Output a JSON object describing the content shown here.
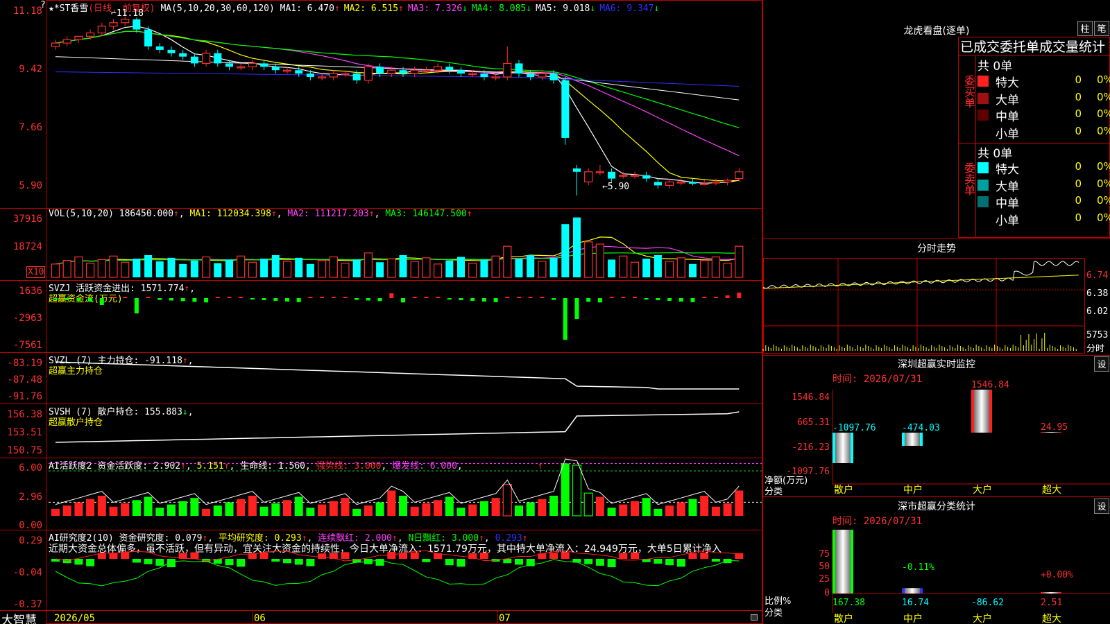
{
  "main_chart": {
    "stock_name": "★*ST香雪",
    "period": "(日线, 前复权)",
    "ma_header": "MA(5,10,20,30,60,120)",
    "ma": [
      {
        "label": "MA1:",
        "value": "6.470",
        "arrow": "↑",
        "color": "#ffffff"
      },
      {
        "label": "MA2:",
        "value": "6.515",
        "arrow": "↑",
        "color": "#ffff00"
      },
      {
        "label": "MA3:",
        "value": "7.326",
        "arrow": "↓",
        "color": "#ff40ff"
      },
      {
        "label": "MA4:",
        "value": "8.085",
        "arrow": "↓",
        "color": "#00ff00"
      },
      {
        "label": "MA5:",
        "value": "9.018",
        "arrow": "↓",
        "color": "#ffffff"
      },
      {
        "label": "MA6:",
        "value": "9.347",
        "arrow": "↓",
        "color": "#3030ff"
      }
    ],
    "y_ticks": [
      "11.18",
      "9.42",
      "7.66",
      "5.90"
    ],
    "high_marker": "11.18",
    "low_marker": "←5.90",
    "help_mark": "?"
  },
  "vol": {
    "header": "VOL(5,10,20)",
    "value": "186450.000",
    "ma1": "112034.398",
    "ma2": "111217.203",
    "ma3": "146147.500",
    "ticks": [
      "37916",
      "18724"
    ],
    "unit": "X10"
  },
  "svzj": {
    "header": "SVZJ  活跃资金进出:",
    "value": "1571.774",
    "sub": "超赢资金流(万元)",
    "ticks": [
      "1636",
      "-2963",
      "-7561"
    ]
  },
  "svzl": {
    "header": "SVZL (7) 主力持仓:",
    "value": "-91.118",
    "sub": "超赢主力持仓",
    "ticks": [
      "-83.19",
      "-87.48",
      "-91.76"
    ]
  },
  "svsh": {
    "header": "SVSH (7) 散户持仓:",
    "value": "155.883",
    "sub": "超赢散户持仓",
    "ticks": [
      "156.38",
      "153.51",
      "150.75"
    ]
  },
  "ai_active": {
    "header": "AI活跃度2 资金活跃度:",
    "v1": "2.902",
    "v2": "5.151",
    "life": "生命线:",
    "life_v": "1.560",
    "strong": "强势线:",
    "strong_v": "3.000",
    "burst": "爆发线:",
    "burst_v": "6.000",
    "ticks": [
      "6.00",
      "2.96",
      "0.00"
    ]
  },
  "ai_research": {
    "header": "AI研究度2(10) 资金研究度:",
    "v1": "0.079",
    "avg": "平均研究度:",
    "avg_v": "0.293",
    "cont": "连续飘红:",
    "cont_v": "2.000",
    "nday": "N日飘红:",
    "nday_v": "3.000",
    "v5": "0.293",
    "text": "近期大资金总体偏多，虽不活跃，但有异动，宜关注大资金的持续性，今日大单净流入：1571.79万元，其中特大单净流入：24.949万元，大单5日累计净入",
    "ticks": [
      "0.29",
      "-0.04",
      "-0.37"
    ]
  },
  "bottom_bar": {
    "brand": "大智慧",
    "dates": [
      "2026/05",
      "06",
      "07"
    ]
  },
  "dragon_tiger": {
    "title": "龙虎看盘(逐单)",
    "btn1": "柱",
    "btn2": "笔",
    "subtitle": "已成交委托单成交量统计",
    "buy_label": "委买单",
    "sell_label": "委卖单",
    "buy_total": "共 0单",
    "sell_total": "共 0单",
    "buy_rows": [
      {
        "name": "特大",
        "count": "0",
        "pct": "0%",
        "color": "#ff2020"
      },
      {
        "name": "大单",
        "count": "0",
        "pct": "0%",
        "color": "#a01010"
      },
      {
        "name": "中单",
        "count": "0",
        "pct": "0%",
        "color": "#600000"
      },
      {
        "name": "小单",
        "count": "0",
        "pct": "0%",
        "color": "#000000"
      }
    ],
    "sell_rows": [
      {
        "name": "特大",
        "count": "0",
        "pct": "0%",
        "color": "#00ffff"
      },
      {
        "name": "大单",
        "count": "0",
        "pct": "0%",
        "color": "#00a0a0"
      },
      {
        "name": "中单",
        "count": "0",
        "pct": "0%",
        "color": "#007070"
      },
      {
        "name": "小单",
        "count": "0",
        "pct": "0%",
        "color": "#000000"
      }
    ]
  },
  "intraday": {
    "title": "分时走势",
    "ticks": [
      "6.74",
      "6.38",
      "6.02"
    ],
    "vol_tick": "5753",
    "vol_label": "分时"
  },
  "sz_monitor": {
    "title": "深圳超赢实时监控",
    "set_btn": "设",
    "time": "时间: 2026/07/31",
    "ticks": [
      "1546.84",
      "665.31",
      "-216.23",
      "-1097.76"
    ],
    "ylabel1": "净额(万元)",
    "ylabel2": "分类",
    "categories": [
      "散户",
      "中户",
      "大户",
      "超大"
    ],
    "values": [
      "-1097.76",
      "-474.03",
      "1546.84",
      "24.95"
    ]
  },
  "sz_class": {
    "title": "深市超赢分类统计",
    "set_btn": "设",
    "time": "时间: 2026/07/31",
    "ticks": [
      "75",
      "50",
      "25",
      "0"
    ],
    "ylabel1": "比例%",
    "ylabel2": "分类",
    "categories": [
      "散户",
      "中户",
      "大户",
      "超大"
    ],
    "pct_labels": [
      "-0.11%",
      "+0.00%"
    ],
    "values": [
      "167.38",
      "16.74",
      "-86.62",
      "2.51"
    ]
  },
  "chart_data": {
    "type": "candlestick",
    "title": "★*ST香雪 (日线, 前复权)",
    "ylim": [
      5.9,
      11.18
    ],
    "candles_ohlc": [
      [
        10.3,
        10.5,
        10.2,
        10.4
      ],
      [
        10.4,
        10.6,
        10.3,
        10.5
      ],
      [
        10.5,
        10.6,
        10.4,
        10.6
      ],
      [
        10.6,
        10.8,
        10.5,
        10.7
      ],
      [
        10.7,
        11.0,
        10.6,
        10.9
      ],
      [
        10.9,
        11.1,
        10.8,
        11.0
      ],
      [
        11.0,
        11.18,
        10.9,
        11.1
      ],
      [
        11.1,
        11.15,
        10.7,
        10.8
      ],
      [
        10.8,
        10.9,
        10.2,
        10.3
      ],
      [
        10.3,
        10.4,
        10.1,
        10.2
      ],
      [
        10.2,
        10.3,
        10.0,
        10.1
      ],
      [
        10.1,
        10.2,
        9.9,
        10.0
      ],
      [
        10.0,
        10.1,
        9.7,
        9.8
      ],
      [
        9.8,
        10.2,
        9.7,
        10.1
      ],
      [
        10.1,
        10.2,
        9.7,
        9.8
      ],
      [
        9.8,
        9.9,
        9.6,
        9.7
      ],
      [
        9.7,
        9.8,
        9.6,
        9.7
      ],
      [
        9.7,
        9.9,
        9.6,
        9.8
      ],
      [
        9.8,
        9.9,
        9.6,
        9.7
      ],
      [
        9.7,
        9.8,
        9.5,
        9.6
      ],
      [
        9.6,
        9.7,
        9.5,
        9.6
      ],
      [
        9.6,
        9.7,
        9.4,
        9.5
      ],
      [
        9.5,
        9.6,
        9.3,
        9.4
      ],
      [
        9.4,
        9.5,
        9.3,
        9.4
      ],
      [
        9.4,
        9.6,
        9.3,
        9.5
      ],
      [
        9.5,
        9.6,
        9.4,
        9.5
      ],
      [
        9.5,
        9.6,
        9.2,
        9.3
      ],
      [
        9.3,
        9.8,
        9.2,
        9.7
      ],
      [
        9.7,
        9.8,
        9.4,
        9.5
      ],
      [
        9.5,
        9.7,
        9.4,
        9.6
      ],
      [
        9.6,
        9.7,
        9.4,
        9.5
      ],
      [
        9.5,
        9.7,
        9.4,
        9.6
      ],
      [
        9.6,
        9.7,
        9.5,
        9.6
      ],
      [
        9.6,
        9.8,
        9.5,
        9.7
      ],
      [
        9.7,
        9.8,
        9.5,
        9.6
      ],
      [
        9.6,
        9.7,
        9.4,
        9.5
      ],
      [
        9.5,
        9.6,
        9.4,
        9.5
      ],
      [
        9.5,
        9.6,
        9.3,
        9.4
      ],
      [
        9.4,
        9.5,
        9.3,
        9.4
      ],
      [
        9.4,
        10.3,
        9.3,
        9.8
      ],
      [
        9.8,
        9.9,
        9.4,
        9.5
      ],
      [
        9.5,
        9.6,
        9.3,
        9.4
      ],
      [
        9.4,
        9.6,
        9.3,
        9.5
      ],
      [
        9.5,
        9.6,
        9.2,
        9.3
      ],
      [
        9.3,
        9.4,
        7.4,
        7.6
      ],
      [
        6.7,
        6.8,
        5.9,
        6.6
      ],
      [
        6.3,
        6.7,
        6.2,
        6.6
      ],
      [
        6.6,
        6.8,
        6.5,
        6.6
      ],
      [
        6.6,
        6.7,
        6.3,
        6.4
      ],
      [
        6.5,
        6.6,
        6.4,
        6.5
      ],
      [
        6.5,
        6.6,
        6.4,
        6.5
      ],
      [
        6.5,
        6.6,
        6.3,
        6.4
      ],
      [
        6.3,
        6.4,
        6.1,
        6.2
      ],
      [
        6.2,
        6.4,
        6.1,
        6.3
      ],
      [
        6.3,
        6.4,
        6.2,
        6.3
      ],
      [
        6.3,
        6.4,
        6.2,
        6.25
      ],
      [
        6.25,
        6.35,
        6.2,
        6.25
      ],
      [
        6.3,
        6.4,
        6.2,
        6.3
      ],
      [
        6.3,
        6.4,
        6.2,
        6.35
      ],
      [
        6.4,
        6.7,
        6.3,
        6.6
      ]
    ]
  }
}
